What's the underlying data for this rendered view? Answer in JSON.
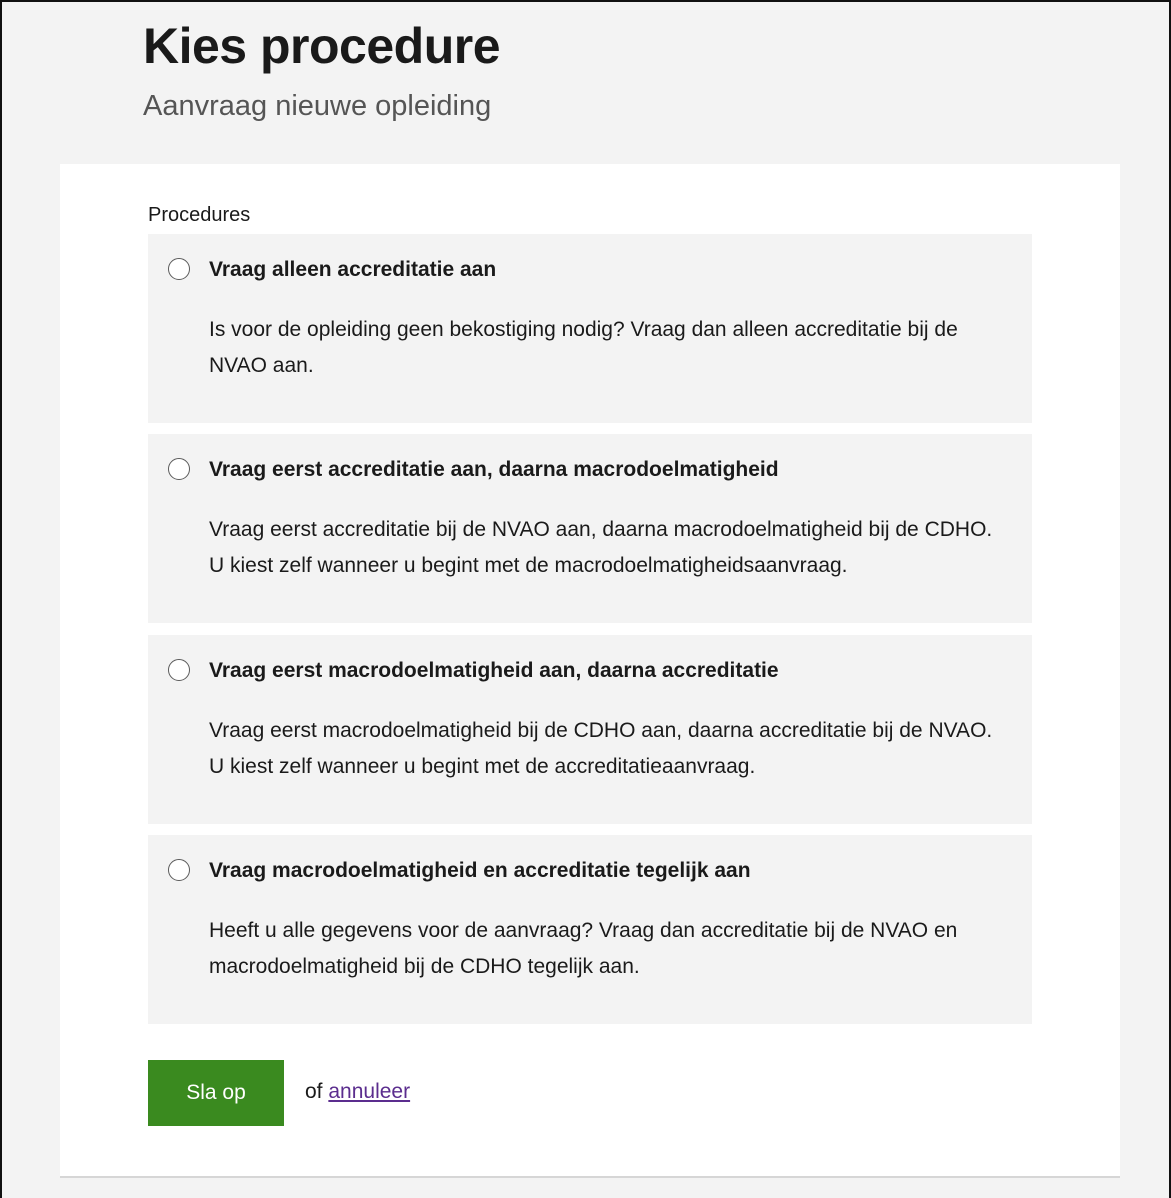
{
  "header": {
    "title": "Kies procedure",
    "subtitle": "Aanvraag nieuwe opleiding"
  },
  "form": {
    "legend": "Procedures",
    "options": [
      {
        "title": "Vraag alleen accreditatie aan",
        "description": "Is voor de opleiding geen bekostiging nodig? Vraag dan alleen accreditatie bij de NVAO aan.",
        "selected": false
      },
      {
        "title": "Vraag eerst accreditatie aan, daarna macrodoelmatigheid",
        "description": "Vraag eerst accreditatie bij de NVAO aan, daarna macrodoelmatigheid bij de CDHO. U kiest zelf wanneer u begint met de macrodoelmatigheidsaanvraag.",
        "selected": false
      },
      {
        "title": "Vraag eerst macrodoelmatigheid aan, daarna accreditatie",
        "description": "Vraag eerst macrodoelmatigheid bij de CDHO aan, daarna accreditatie bij de NVAO. U kiest zelf wanneer u begint met de accreditatieaanvraag.",
        "selected": false
      },
      {
        "title": "Vraag macrodoelmatigheid en accreditatie tegelijk aan",
        "description": "Heeft u alle gegevens voor de aanvraag? Vraag dan accreditatie bij de NVAO en macrodoelmatigheid bij de CDHO tegelijk aan.",
        "selected": false
      }
    ],
    "save_label": "Sla op",
    "or_text": "of",
    "cancel_label": "annuleer"
  },
  "colors": {
    "page_background": "#f3f3f3",
    "card_background": "#ffffff",
    "option_background": "#f3f3f3",
    "primary_button": "#3a8a1f",
    "link": "#5b2d8e"
  }
}
